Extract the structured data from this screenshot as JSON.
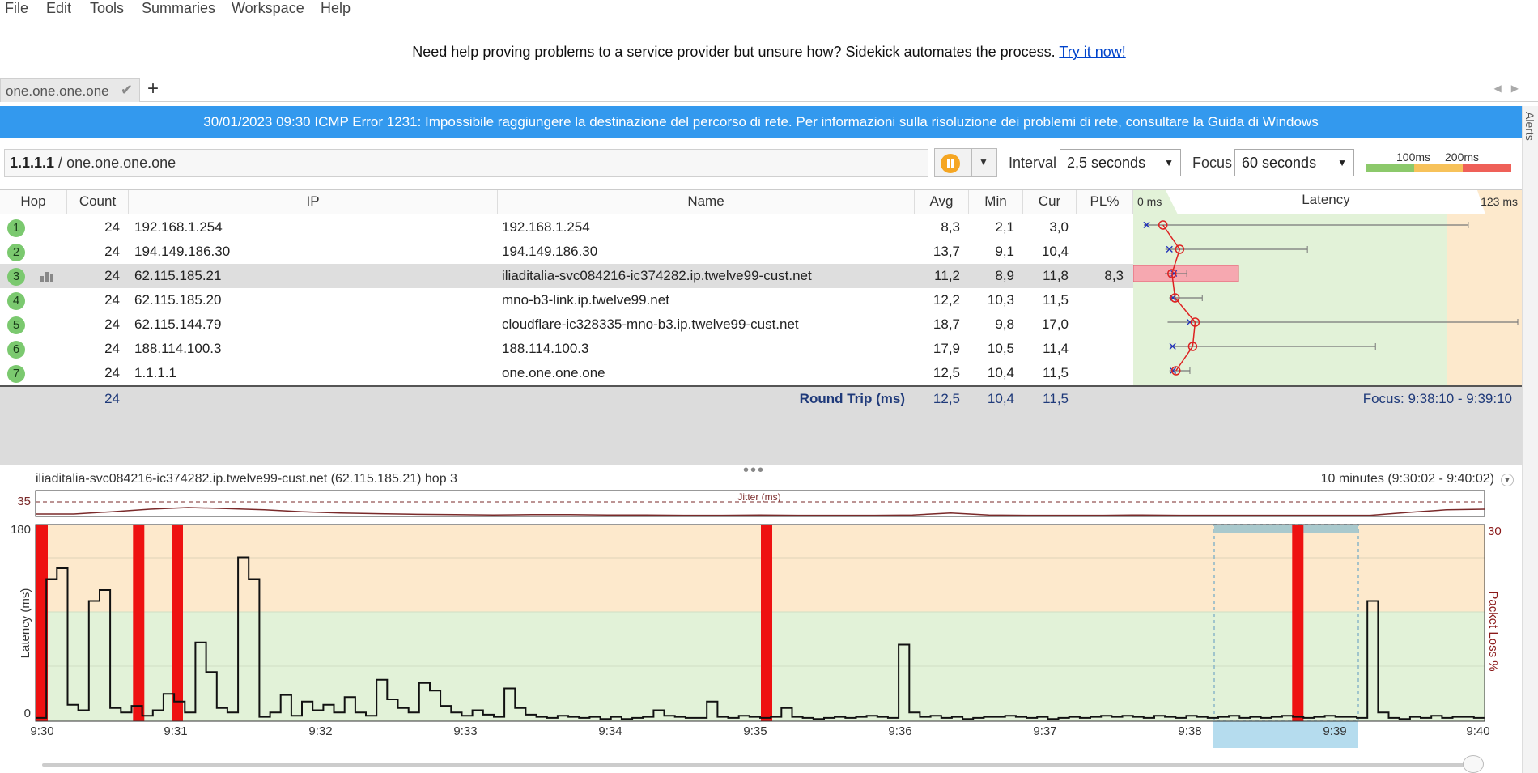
{
  "menu": [
    "File",
    "Edit",
    "Tools",
    "Summaries",
    "Workspace",
    "Help"
  ],
  "promo": {
    "text": "Need help proving problems to a service provider but unsure how? Sidekick automates the process.",
    "link": "Try it now!"
  },
  "tabs": [
    {
      "label": "one.one.one.one"
    }
  ],
  "alert": {
    "text": "30/01/2023 09:30 ICMP Error 1231: Impossibile raggiungere la destinazione del percorso di rete. Per informazioni sulla risoluzione dei problemi di rete, consultare la Guida di Windows"
  },
  "side_label": "Alerts",
  "target": {
    "ip": "1.1.1.1",
    "sep": " / ",
    "host": "one.one.one.one"
  },
  "controls": {
    "interval_label": "Interval",
    "interval_value": "2,5 seconds",
    "focus_label": "Focus",
    "focus_value": "60 seconds",
    "legend_100": "100ms",
    "legend_200": "200ms"
  },
  "columns": {
    "hop": "Hop",
    "count": "Count",
    "ip": "IP",
    "name": "Name",
    "avg": "Avg",
    "min": "Min",
    "cur": "Cur",
    "pl": "PL%",
    "lat_min": "0 ms",
    "lat_title": "Latency",
    "lat_max": "123 ms"
  },
  "rows": [
    {
      "hop": "1",
      "count": "24",
      "ip": "192.168.1.254",
      "name": "192.168.1.254",
      "avg": "8,3",
      "min": "2,1",
      "cur": "3,0",
      "pl": ""
    },
    {
      "hop": "2",
      "count": "24",
      "ip": "194.149.186.30",
      "name": "194.149.186.30",
      "avg": "13,7",
      "min": "9,1",
      "cur": "10,4",
      "pl": ""
    },
    {
      "hop": "3",
      "count": "24",
      "ip": "62.115.185.21",
      "name": "iliaditalia-svc084216-ic374282.ip.twelve99-cust.net",
      "avg": "11,2",
      "min": "8,9",
      "cur": "11,8",
      "pl": "8,3"
    },
    {
      "hop": "4",
      "count": "24",
      "ip": "62.115.185.20",
      "name": "mno-b3-link.ip.twelve99.net",
      "avg": "12,2",
      "min": "10,3",
      "cur": "11,5",
      "pl": ""
    },
    {
      "hop": "5",
      "count": "24",
      "ip": "62.115.144.79",
      "name": "cloudflare-ic328335-mno-b3.ip.twelve99-cust.net",
      "avg": "18,7",
      "min": "9,8",
      "cur": "17,0",
      "pl": ""
    },
    {
      "hop": "6",
      "count": "24",
      "ip": "188.114.100.3",
      "name": "188.114.100.3",
      "avg": "17,9",
      "min": "10,5",
      "cur": "11,4",
      "pl": ""
    },
    {
      "hop": "7",
      "count": "24",
      "ip": "1.1.1.1",
      "name": "one.one.one.one",
      "avg": "12,5",
      "min": "10,4",
      "cur": "11,5",
      "pl": ""
    }
  ],
  "round_trip": {
    "count": "24",
    "label": "Round Trip (ms)",
    "avg": "12,5",
    "min": "10,4",
    "cur": "11,5",
    "focus": "Focus: 9:38:10 - 9:39:10"
  },
  "hop_latency": {
    "axis_max_ms": 123,
    "hops": [
      {
        "min": 2.1,
        "avg": 8.3,
        "cur": 3.0,
        "max": 107
      },
      {
        "min": 9.1,
        "avg": 13.7,
        "cur": 10.4,
        "max": 55
      },
      {
        "min": 8.9,
        "avg": 11.2,
        "cur": 11.8,
        "max": 16,
        "loss_pct": 8.3
      },
      {
        "min": 10.3,
        "avg": 12.2,
        "cur": 11.5,
        "max": 21
      },
      {
        "min": 9.8,
        "avg": 18.7,
        "cur": 17.0,
        "max": 123
      },
      {
        "min": 10.5,
        "avg": 17.9,
        "cur": 11.4,
        "max": 77
      },
      {
        "min": 10.4,
        "avg": 12.5,
        "cur": 11.5,
        "max": 17
      }
    ]
  },
  "detail": {
    "title": "iliaditalia-svc084216-ic374282.ip.twelve99-cust.net (62.115.185.21) hop 3",
    "range": "10 minutes (9:30:02 - 9:40:02)",
    "jitter_label": "Jitter (ms)",
    "jitter_tick": "35",
    "y_max": "180",
    "y_zero": "0",
    "y_label": "Latency (ms)",
    "y2_max": "30",
    "y2_label": "Packet Loss %",
    "x_ticks": [
      "9:30",
      "9:31",
      "9:32",
      "9:33",
      "9:34",
      "9:35",
      "9:36",
      "9:37",
      "9:38",
      "9:39",
      "9:40"
    ]
  },
  "chart_data": {
    "type": "line",
    "ylabel": "Latency (ms)",
    "ylim": [
      0,
      180
    ],
    "y2label": "Packet Loss %",
    "y2lim": [
      0,
      30
    ],
    "x_range": [
      "9:30:02",
      "9:40:02"
    ],
    "latency_ms": [
      3,
      130,
      140,
      15,
      10,
      110,
      120,
      12,
      8,
      14,
      5,
      10,
      25,
      18,
      8,
      72,
      45,
      12,
      8,
      150,
      130,
      4,
      8,
      24,
      5,
      18,
      10,
      15,
      8,
      22,
      8,
      5,
      38,
      20,
      12,
      8,
      35,
      28,
      14,
      8,
      5,
      10,
      6,
      4,
      30,
      12,
      6,
      4,
      3,
      5,
      4,
      3,
      4,
      2,
      4,
      2,
      3,
      4,
      10,
      5,
      4,
      3,
      3,
      18,
      4,
      3,
      5,
      4,
      3,
      4,
      12,
      4,
      3,
      2,
      3,
      4,
      3,
      4,
      5,
      4,
      3,
      70,
      8,
      4,
      5,
      3,
      4,
      2,
      3,
      4,
      4,
      5,
      4,
      3,
      4,
      2,
      3,
      4,
      3,
      4,
      5,
      4,
      5,
      4,
      3,
      5,
      4,
      3,
      5,
      4,
      3,
      4,
      5,
      3,
      4,
      3,
      4,
      5,
      4,
      3,
      4,
      5,
      4,
      4,
      3,
      110,
      8,
      3,
      2,
      4,
      3,
      5,
      3,
      4,
      4,
      3
    ],
    "packet_loss_events": [
      "9:30:05",
      "9:30:45",
      "9:31:01",
      "9:35:05",
      "9:38:45"
    ],
    "jitter_ms": [
      5,
      5,
      12,
      20,
      25,
      22,
      18,
      12,
      8,
      6,
      4,
      3,
      2,
      3,
      3,
      2,
      2,
      1,
      1,
      2,
      1,
      1,
      1,
      2,
      8,
      2,
      1,
      1,
      1,
      2,
      1,
      1,
      1,
      1,
      1,
      1,
      10,
      18,
      20
    ]
  }
}
